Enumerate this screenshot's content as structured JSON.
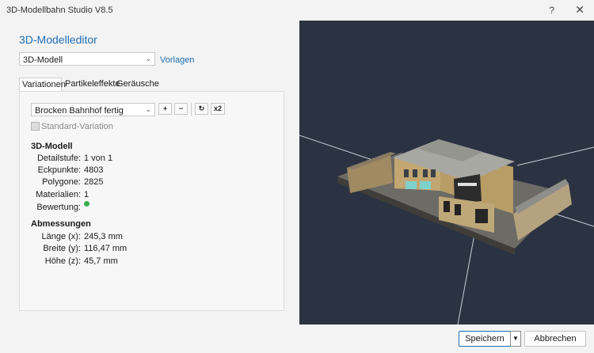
{
  "window": {
    "title": "3D-Modellbahn Studio V8.5",
    "help": "?",
    "close": "✕"
  },
  "heading": "3D-Modelleditor",
  "model_select": {
    "value": "3D-Modell"
  },
  "vorlagen_link": "Vorlagen",
  "tabs": [
    {
      "label": "Variationen",
      "active": true
    },
    {
      "label": "Partikeleffekte",
      "active": false
    },
    {
      "label": "Geräusche",
      "active": false
    }
  ],
  "variation_select": {
    "value": "Brocken Bahnhof fertig"
  },
  "variation_buttons": {
    "add": "+",
    "remove": "−",
    "refresh": "↻",
    "double": "x2"
  },
  "standard_variation": {
    "label": "Standard-Variation",
    "checked": false,
    "disabled": true
  },
  "model_info": {
    "heading": "3D-Modell",
    "rows": [
      {
        "label": "Detailstufe:",
        "value": "1 von 1"
      },
      {
        "label": "Eckpunkte:",
        "value": "4803"
      },
      {
        "label": "Polygone:",
        "value": "2825"
      },
      {
        "label": "Materialien:",
        "value": "1"
      },
      {
        "label": "Bewertung:",
        "value": ""
      }
    ],
    "rating_color": "#3bae49"
  },
  "dimensions": {
    "heading": "Abmessungen",
    "rows": [
      {
        "label": "Länge (x):",
        "value": "245,3 mm"
      },
      {
        "label": "Breite (y):",
        "value": "116,47 mm"
      },
      {
        "label": "Höhe (z):",
        "value": "45,7 mm"
      }
    ]
  },
  "footer": {
    "save": "Speichern",
    "save_dropdown": "▼",
    "cancel": "Abbrechen"
  },
  "colors": {
    "accent": "#1e6eb4",
    "viewport_bg": "#2b3342"
  }
}
